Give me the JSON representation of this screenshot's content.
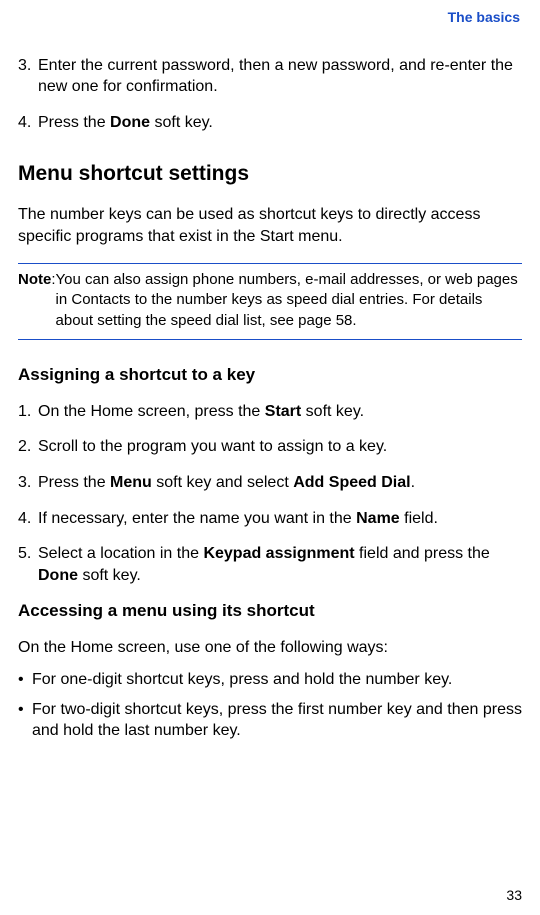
{
  "header": {
    "breadcrumb": "The basics"
  },
  "intro_steps": {
    "s3": {
      "num": "3.",
      "text": "Enter the current password, then a new password, and re-enter the new one for confirmation."
    },
    "s4": {
      "num": "4.",
      "pre": "Press the ",
      "bold": "Done",
      "post": " soft key."
    }
  },
  "section1": {
    "title": "Menu shortcut settings",
    "intro": "The number keys can be used as shortcut keys to directly access specific programs that exist in the Start menu."
  },
  "note": {
    "label": "Note",
    "colon": ": ",
    "body": "You can also assign phone numbers, e-mail addresses, or web pages in Contacts to the number keys as speed dial entries. For details about setting the speed dial list, see page 58."
  },
  "sub1": {
    "title": "Assigning a shortcut to a key",
    "s1": {
      "num": "1.",
      "pre": "On the Home screen, press the ",
      "bold": "Start",
      "post": " soft key."
    },
    "s2": {
      "num": "2.",
      "text": "Scroll to the program you want to assign to a key."
    },
    "s3": {
      "num": "3.",
      "pre": "Press the ",
      "bold1": "Menu",
      "mid": " soft key and select ",
      "bold2": "Add Speed Dial",
      "post": "."
    },
    "s4": {
      "num": "4.",
      "pre": "If necessary, enter the name you want in the ",
      "bold": "Name",
      "post": " field."
    },
    "s5": {
      "num": "5.",
      "pre": "Select a location in the ",
      "bold1": "Keypad assignment",
      "mid": " field and press the ",
      "bold2": "Done",
      "post": " soft key."
    }
  },
  "sub2": {
    "title": "Accessing a menu using its shortcut",
    "intro": "On the Home screen, use one of the following ways:",
    "b1": "For one-digit shortcut keys, press and hold the number key.",
    "b2": "For two-digit shortcut keys, press the first number key and then press and hold the last number key."
  },
  "page_number": "33",
  "bullet": "•"
}
